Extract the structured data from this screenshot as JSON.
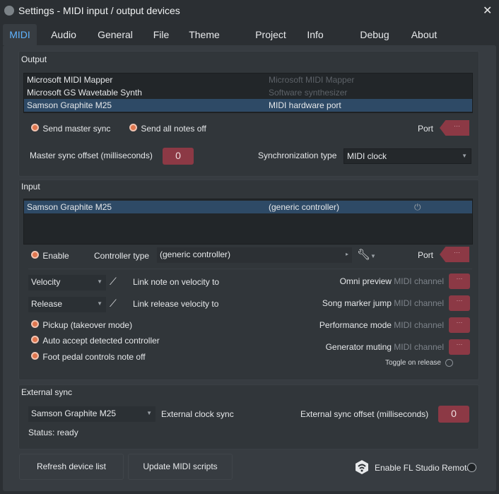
{
  "window": {
    "title": "Settings - MIDI input / output devices",
    "close": "✕"
  },
  "tabs": [
    "MIDI",
    "Audio",
    "General",
    "File",
    "Theme",
    "Project",
    "Info",
    "Debug",
    "About"
  ],
  "output": {
    "title": "Output",
    "devices": [
      {
        "name": "Microsoft MIDI Mapper",
        "type": "Microsoft MIDI Mapper",
        "dim": true
      },
      {
        "name": "Microsoft GS Wavetable Synth",
        "type": "Software synthesizer",
        "dim": true
      },
      {
        "name": "Samson Graphite M25",
        "type": "MIDI hardware port",
        "selected": true
      }
    ],
    "send_master_sync": "Send master sync",
    "send_all_notes_off": "Send all notes off",
    "port_label": "Port",
    "port_dots": "···",
    "master_sync_offset_label": "Master sync offset (milliseconds)",
    "master_sync_offset_value": "0",
    "sync_type_label": "Synchronization type",
    "sync_type_value": "MIDI clock"
  },
  "input": {
    "title": "Input",
    "devices": [
      {
        "name": "Samson Graphite M25",
        "type": "(generic controller)",
        "selected": true
      }
    ],
    "enable_label": "Enable",
    "controller_type_label": "Controller type",
    "controller_type_value": "(generic controller)",
    "port_label": "Port",
    "port_dots": "···",
    "velocity_dd": "Velocity",
    "link_note_velocity": "Link note on velocity to",
    "release_dd": "Release",
    "link_release_velocity": "Link release velocity to",
    "pickup": "Pickup (takeover mode)",
    "auto_accept": "Auto accept detected controller",
    "foot_pedal": "Foot pedal controls note off",
    "channels": [
      {
        "label": "Omni preview",
        "suffix": "MIDI channel"
      },
      {
        "label": "Song marker jump",
        "suffix": "MIDI channel"
      },
      {
        "label": "Performance mode",
        "suffix": "MIDI channel"
      },
      {
        "label": "Generator muting",
        "suffix": "MIDI channel"
      }
    ],
    "channel_dots": "···",
    "toggle_on_release": "Toggle on release"
  },
  "external_sync": {
    "title": "External sync",
    "device": "Samson Graphite M25",
    "clock_label": "External clock sync",
    "offset_label": "External sync offset (milliseconds)",
    "offset_value": "0",
    "status": "Status: ready"
  },
  "bottom": {
    "refresh": "Refresh device list",
    "update": "Update MIDI scripts",
    "remote": "Enable FL Studio Remote"
  },
  "colors": {
    "accent": "#5fb3ff",
    "red": "#8c3945",
    "selection": "#2e4a66"
  }
}
